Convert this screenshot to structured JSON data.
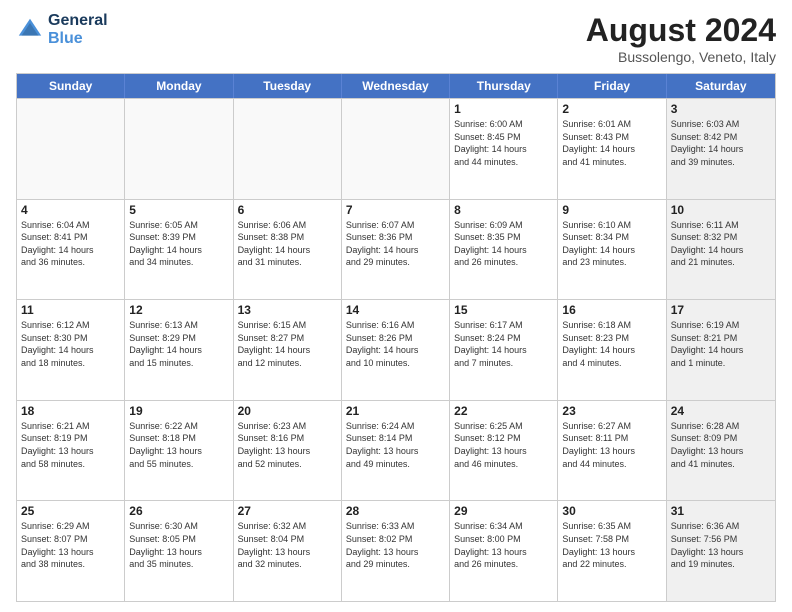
{
  "logo": {
    "line1": "General",
    "line2": "Blue"
  },
  "title": "August 2024",
  "location": "Bussolengo, Veneto, Italy",
  "days_of_week": [
    "Sunday",
    "Monday",
    "Tuesday",
    "Wednesday",
    "Thursday",
    "Friday",
    "Saturday"
  ],
  "rows": [
    [
      {
        "day": "",
        "info": "",
        "empty": true
      },
      {
        "day": "",
        "info": "",
        "empty": true
      },
      {
        "day": "",
        "info": "",
        "empty": true
      },
      {
        "day": "",
        "info": "",
        "empty": true
      },
      {
        "day": "1",
        "info": "Sunrise: 6:00 AM\nSunset: 8:45 PM\nDaylight: 14 hours\nand 44 minutes."
      },
      {
        "day": "2",
        "info": "Sunrise: 6:01 AM\nSunset: 8:43 PM\nDaylight: 14 hours\nand 41 minutes."
      },
      {
        "day": "3",
        "info": "Sunrise: 6:03 AM\nSunset: 8:42 PM\nDaylight: 14 hours\nand 39 minutes.",
        "shaded": true
      }
    ],
    [
      {
        "day": "4",
        "info": "Sunrise: 6:04 AM\nSunset: 8:41 PM\nDaylight: 14 hours\nand 36 minutes."
      },
      {
        "day": "5",
        "info": "Sunrise: 6:05 AM\nSunset: 8:39 PM\nDaylight: 14 hours\nand 34 minutes."
      },
      {
        "day": "6",
        "info": "Sunrise: 6:06 AM\nSunset: 8:38 PM\nDaylight: 14 hours\nand 31 minutes."
      },
      {
        "day": "7",
        "info": "Sunrise: 6:07 AM\nSunset: 8:36 PM\nDaylight: 14 hours\nand 29 minutes."
      },
      {
        "day": "8",
        "info": "Sunrise: 6:09 AM\nSunset: 8:35 PM\nDaylight: 14 hours\nand 26 minutes."
      },
      {
        "day": "9",
        "info": "Sunrise: 6:10 AM\nSunset: 8:34 PM\nDaylight: 14 hours\nand 23 minutes."
      },
      {
        "day": "10",
        "info": "Sunrise: 6:11 AM\nSunset: 8:32 PM\nDaylight: 14 hours\nand 21 minutes.",
        "shaded": true
      }
    ],
    [
      {
        "day": "11",
        "info": "Sunrise: 6:12 AM\nSunset: 8:30 PM\nDaylight: 14 hours\nand 18 minutes."
      },
      {
        "day": "12",
        "info": "Sunrise: 6:13 AM\nSunset: 8:29 PM\nDaylight: 14 hours\nand 15 minutes."
      },
      {
        "day": "13",
        "info": "Sunrise: 6:15 AM\nSunset: 8:27 PM\nDaylight: 14 hours\nand 12 minutes."
      },
      {
        "day": "14",
        "info": "Sunrise: 6:16 AM\nSunset: 8:26 PM\nDaylight: 14 hours\nand 10 minutes."
      },
      {
        "day": "15",
        "info": "Sunrise: 6:17 AM\nSunset: 8:24 PM\nDaylight: 14 hours\nand 7 minutes."
      },
      {
        "day": "16",
        "info": "Sunrise: 6:18 AM\nSunset: 8:23 PM\nDaylight: 14 hours\nand 4 minutes."
      },
      {
        "day": "17",
        "info": "Sunrise: 6:19 AM\nSunset: 8:21 PM\nDaylight: 14 hours\nand 1 minute.",
        "shaded": true
      }
    ],
    [
      {
        "day": "18",
        "info": "Sunrise: 6:21 AM\nSunset: 8:19 PM\nDaylight: 13 hours\nand 58 minutes."
      },
      {
        "day": "19",
        "info": "Sunrise: 6:22 AM\nSunset: 8:18 PM\nDaylight: 13 hours\nand 55 minutes."
      },
      {
        "day": "20",
        "info": "Sunrise: 6:23 AM\nSunset: 8:16 PM\nDaylight: 13 hours\nand 52 minutes."
      },
      {
        "day": "21",
        "info": "Sunrise: 6:24 AM\nSunset: 8:14 PM\nDaylight: 13 hours\nand 49 minutes."
      },
      {
        "day": "22",
        "info": "Sunrise: 6:25 AM\nSunset: 8:12 PM\nDaylight: 13 hours\nand 46 minutes."
      },
      {
        "day": "23",
        "info": "Sunrise: 6:27 AM\nSunset: 8:11 PM\nDaylight: 13 hours\nand 44 minutes."
      },
      {
        "day": "24",
        "info": "Sunrise: 6:28 AM\nSunset: 8:09 PM\nDaylight: 13 hours\nand 41 minutes.",
        "shaded": true
      }
    ],
    [
      {
        "day": "25",
        "info": "Sunrise: 6:29 AM\nSunset: 8:07 PM\nDaylight: 13 hours\nand 38 minutes."
      },
      {
        "day": "26",
        "info": "Sunrise: 6:30 AM\nSunset: 8:05 PM\nDaylight: 13 hours\nand 35 minutes."
      },
      {
        "day": "27",
        "info": "Sunrise: 6:32 AM\nSunset: 8:04 PM\nDaylight: 13 hours\nand 32 minutes."
      },
      {
        "day": "28",
        "info": "Sunrise: 6:33 AM\nSunset: 8:02 PM\nDaylight: 13 hours\nand 29 minutes."
      },
      {
        "day": "29",
        "info": "Sunrise: 6:34 AM\nSunset: 8:00 PM\nDaylight: 13 hours\nand 26 minutes."
      },
      {
        "day": "30",
        "info": "Sunrise: 6:35 AM\nSunset: 7:58 PM\nDaylight: 13 hours\nand 22 minutes."
      },
      {
        "day": "31",
        "info": "Sunrise: 6:36 AM\nSunset: 7:56 PM\nDaylight: 13 hours\nand 19 minutes.",
        "shaded": true
      }
    ]
  ]
}
